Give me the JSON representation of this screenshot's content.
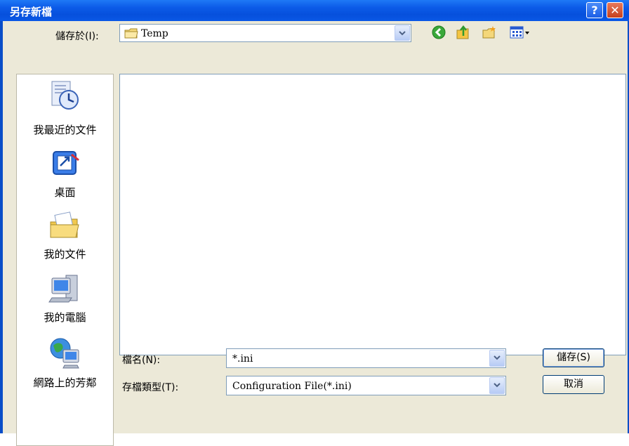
{
  "window": {
    "title": "另存新檔",
    "help_glyph": "?",
    "close_glyph": "✕"
  },
  "toolbar": {
    "location_label": "儲存於(I):",
    "location_value": "Temp"
  },
  "places": [
    {
      "label": "我最近的文件",
      "icon": "recent-documents-icon"
    },
    {
      "label": "桌面",
      "icon": "desktop-icon"
    },
    {
      "label": "我的文件",
      "icon": "my-documents-icon"
    },
    {
      "label": "我的電腦",
      "icon": "my-computer-icon"
    },
    {
      "label": "網路上的芳鄰",
      "icon": "network-places-icon"
    }
  ],
  "form": {
    "filename_label": "檔名(N):",
    "filename_value": "*.ini",
    "filetype_label": "存檔類型(T):",
    "filetype_value": "Configuration File(*.ini)"
  },
  "buttons": {
    "save": "儲存(S)",
    "cancel": "取消"
  },
  "colors": {
    "title_bar": "#0a58e6",
    "dialog_bg": "#ece9d8",
    "close_button": "#c6401c"
  }
}
